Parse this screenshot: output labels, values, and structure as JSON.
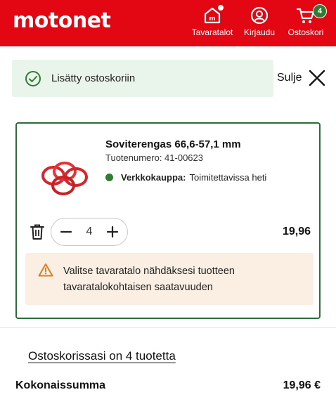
{
  "header": {
    "logo_text": "motonet",
    "brand_color": "#e30613",
    "nav": {
      "stores_label": "Tavaratalot",
      "login_label": "Kirjaudu",
      "cart_label": "Ostoskori",
      "cart_count": "4"
    }
  },
  "toast": {
    "message": "Lisätty ostoskoriin",
    "close_label": "Sulje"
  },
  "product": {
    "name": "Soviterengas 66,6-57,1 mm",
    "number_text": "Tuotenumero: 41-00623",
    "availability_channel": "Verkkokauppa:",
    "availability_status": "Toimitettavissa heti",
    "quantity": "4",
    "line_price": "19,96",
    "store_notice": "Valitse tavaratalo nähdäksesi tuotteen tavaratalokohtaisen saatavuuden"
  },
  "summary": {
    "count_link": "Ostoskorissasi on 4 tuotetta",
    "total_label": "Kokonaissumma",
    "total_value": "19,96 €"
  },
  "icons": {
    "stores": "store-icon",
    "login": "user-icon",
    "cart": "cart-icon",
    "toast": "check-circle-icon",
    "close": "close-icon",
    "delete": "trash-icon",
    "decrement": "minus-icon",
    "increment": "plus-icon",
    "warning": "warning-icon"
  },
  "colors": {
    "success_green": "#2e7d32",
    "card_border": "#2e6b3a",
    "toast_bg": "#e9f4ea",
    "notice_bg": "#fbeee3",
    "warning_orange": "#e07b1f"
  }
}
